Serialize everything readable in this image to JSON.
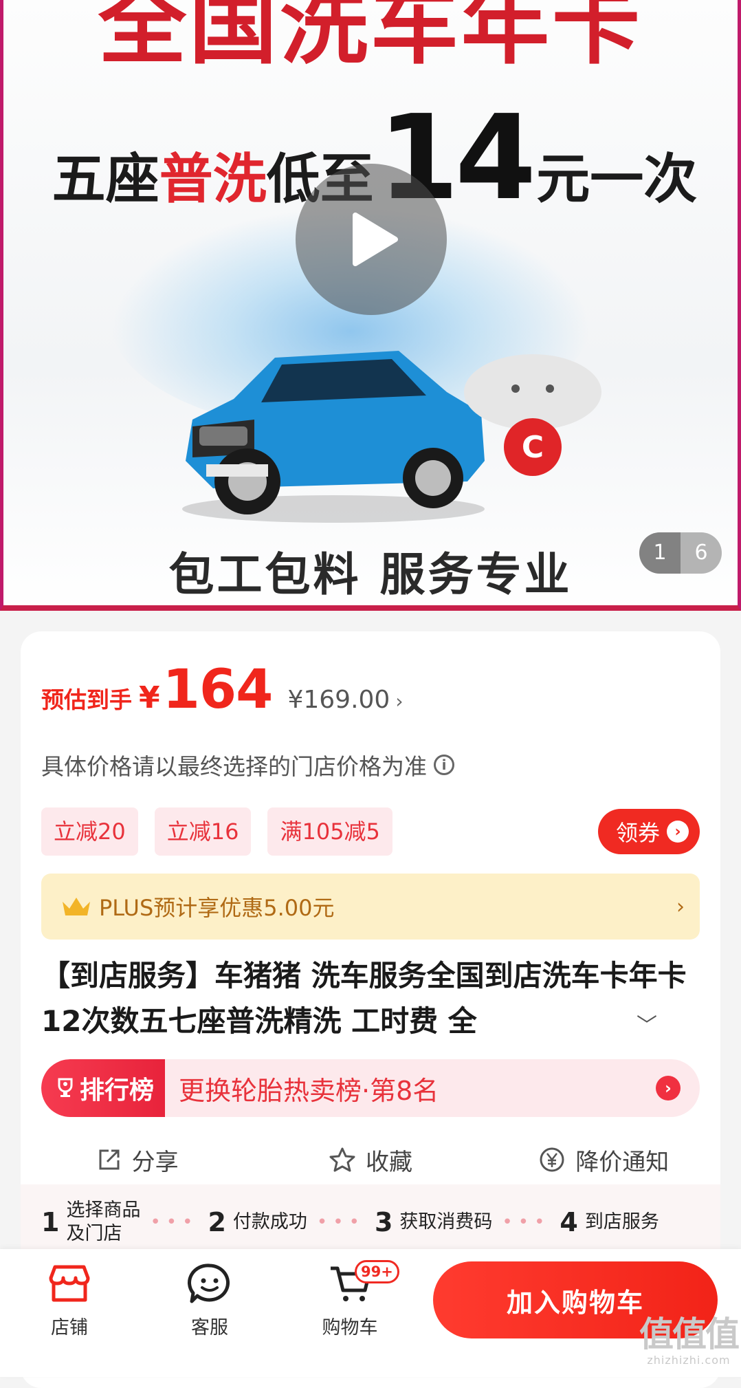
{
  "banner": {
    "title": "全国洗车年卡",
    "sub_part1": "五座",
    "sub_part2": "普洗",
    "sub_part3": "低至",
    "sub_number": "14",
    "sub_part4": "元一次",
    "bottom_text": "包工包料 服务专业",
    "mascot_letter": "C",
    "pager_current": "1",
    "pager_total": "6"
  },
  "price": {
    "label": "预估到手",
    "currency": "¥",
    "value": "164",
    "original": "¥169.00",
    "original_arrow": "›"
  },
  "note": "具体价格请以最终选择的门店价格为准",
  "coupons": [
    "立减20",
    "立减16",
    "满105减5"
  ],
  "get_coupon_label": "领券",
  "plus": {
    "text": "PLUS预计享优惠5.00元",
    "arrow": "›"
  },
  "product_title": "【到店服务】车猪猪 洗车服务全国到店洗车卡年卡12次数五七座普洗精洗 工时费 全",
  "rank": {
    "tag": "排行榜",
    "text": "更换轮胎热卖榜·第8名"
  },
  "actions": {
    "share": "分享",
    "favorite": "收藏",
    "price_alert": "降价通知"
  },
  "steps": [
    {
      "num": "1",
      "label_line1": "选择商品",
      "label_line2": "及门店"
    },
    {
      "num": "2",
      "label_line1": "付款成功",
      "label_line2": ""
    },
    {
      "num": "3",
      "label_line1": "获取消费码",
      "label_line2": ""
    },
    {
      "num": "4",
      "label_line1": "到店服务",
      "label_line2": ""
    }
  ],
  "bottombar": {
    "store": "店铺",
    "service": "客服",
    "cart": "购物车",
    "cart_badge": "99+",
    "add_to_cart": "加入购物车"
  },
  "watermark": {
    "big": "值值值",
    "small": "zhizhizhi.com"
  },
  "colors": {
    "accent_red": "#f0261c",
    "plus_gold": "#b06a15",
    "coupon_bg": "#fde9ec"
  }
}
